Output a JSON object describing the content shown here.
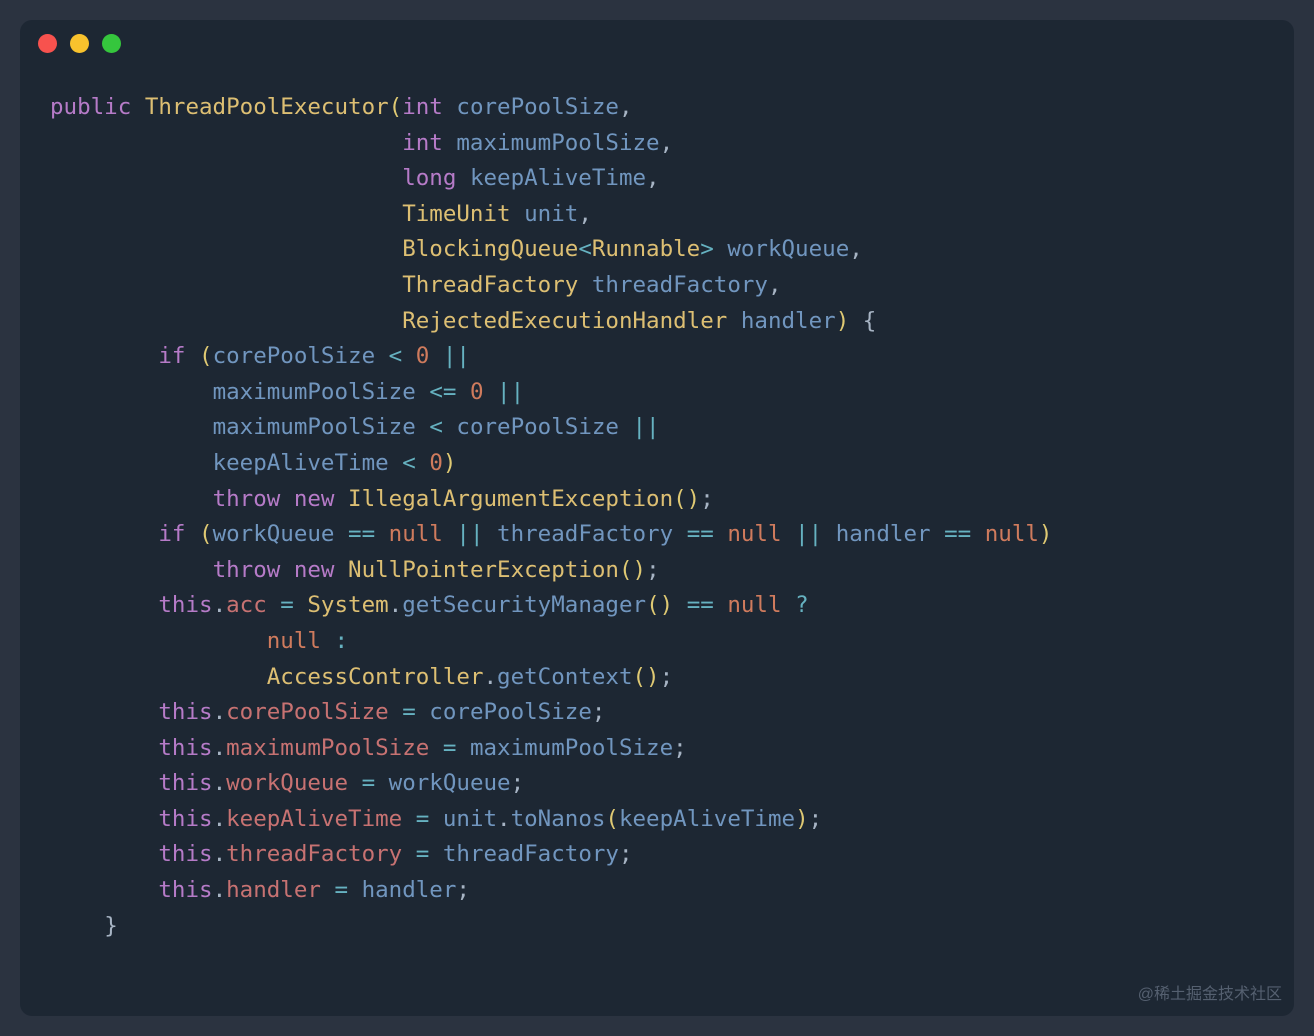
{
  "titlebar": {
    "dots": [
      "red",
      "yellow",
      "green"
    ]
  },
  "code": {
    "tokens": [
      [
        {
          "t": "public",
          "c": "kw-public"
        },
        {
          "t": " ",
          "c": ""
        },
        {
          "t": "ThreadPoolExecutor",
          "c": "kw-type"
        },
        {
          "t": "(",
          "c": "paren"
        },
        {
          "t": "int",
          "c": "kw-int"
        },
        {
          "t": " ",
          "c": ""
        },
        {
          "t": "corePoolSize",
          "c": "param"
        },
        {
          "t": ",",
          "c": "punct"
        }
      ],
      [
        {
          "t": "                          ",
          "c": ""
        },
        {
          "t": "int",
          "c": "kw-int"
        },
        {
          "t": " ",
          "c": ""
        },
        {
          "t": "maximumPoolSize",
          "c": "param"
        },
        {
          "t": ",",
          "c": "punct"
        }
      ],
      [
        {
          "t": "                          ",
          "c": ""
        },
        {
          "t": "long",
          "c": "kw-long"
        },
        {
          "t": " ",
          "c": ""
        },
        {
          "t": "keepAliveTime",
          "c": "param"
        },
        {
          "t": ",",
          "c": "punct"
        }
      ],
      [
        {
          "t": "                          ",
          "c": ""
        },
        {
          "t": "TimeUnit",
          "c": "kw-type"
        },
        {
          "t": " ",
          "c": ""
        },
        {
          "t": "unit",
          "c": "param"
        },
        {
          "t": ",",
          "c": "punct"
        }
      ],
      [
        {
          "t": "                          ",
          "c": ""
        },
        {
          "t": "BlockingQueue",
          "c": "kw-type"
        },
        {
          "t": "<",
          "c": "generic"
        },
        {
          "t": "Runnable",
          "c": "kw-type"
        },
        {
          "t": ">",
          "c": "generic"
        },
        {
          "t": " ",
          "c": ""
        },
        {
          "t": "workQueue",
          "c": "param"
        },
        {
          "t": ",",
          "c": "punct"
        }
      ],
      [
        {
          "t": "                          ",
          "c": ""
        },
        {
          "t": "ThreadFactory",
          "c": "kw-type"
        },
        {
          "t": " ",
          "c": ""
        },
        {
          "t": "threadFactory",
          "c": "param"
        },
        {
          "t": ",",
          "c": "punct"
        }
      ],
      [
        {
          "t": "                          ",
          "c": ""
        },
        {
          "t": "RejectedExecutionHandler",
          "c": "kw-type"
        },
        {
          "t": " ",
          "c": ""
        },
        {
          "t": "handler",
          "c": "param"
        },
        {
          "t": ")",
          "c": "paren"
        },
        {
          "t": " ",
          "c": ""
        },
        {
          "t": "{",
          "c": "curly"
        }
      ],
      [
        {
          "t": "        ",
          "c": ""
        },
        {
          "t": "if",
          "c": "kw-if"
        },
        {
          "t": " ",
          "c": ""
        },
        {
          "t": "(",
          "c": "paren"
        },
        {
          "t": "corePoolSize ",
          "c": "param"
        },
        {
          "t": "<",
          "c": "op"
        },
        {
          "t": " ",
          "c": ""
        },
        {
          "t": "0",
          "c": "num"
        },
        {
          "t": " ",
          "c": ""
        },
        {
          "t": "||",
          "c": "op"
        }
      ],
      [
        {
          "t": "            ",
          "c": ""
        },
        {
          "t": "maximumPoolSize ",
          "c": "param"
        },
        {
          "t": "<=",
          "c": "op"
        },
        {
          "t": " ",
          "c": ""
        },
        {
          "t": "0",
          "c": "num"
        },
        {
          "t": " ",
          "c": ""
        },
        {
          "t": "||",
          "c": "op"
        }
      ],
      [
        {
          "t": "            ",
          "c": ""
        },
        {
          "t": "maximumPoolSize ",
          "c": "param"
        },
        {
          "t": "<",
          "c": "op"
        },
        {
          "t": " corePoolSize ",
          "c": "param"
        },
        {
          "t": "||",
          "c": "op"
        }
      ],
      [
        {
          "t": "            ",
          "c": ""
        },
        {
          "t": "keepAliveTime ",
          "c": "param"
        },
        {
          "t": "<",
          "c": "op"
        },
        {
          "t": " ",
          "c": ""
        },
        {
          "t": "0",
          "c": "num"
        },
        {
          "t": ")",
          "c": "paren"
        }
      ],
      [
        {
          "t": "            ",
          "c": ""
        },
        {
          "t": "throw",
          "c": "kw-throw"
        },
        {
          "t": " ",
          "c": ""
        },
        {
          "t": "new",
          "c": "kw-new"
        },
        {
          "t": " ",
          "c": ""
        },
        {
          "t": "IllegalArgumentException",
          "c": "kw-type"
        },
        {
          "t": "()",
          "c": "paren"
        },
        {
          "t": ";",
          "c": "punct"
        }
      ],
      [
        {
          "t": "        ",
          "c": ""
        },
        {
          "t": "if",
          "c": "kw-if"
        },
        {
          "t": " ",
          "c": ""
        },
        {
          "t": "(",
          "c": "paren"
        },
        {
          "t": "workQueue ",
          "c": "param"
        },
        {
          "t": "==",
          "c": "op"
        },
        {
          "t": " ",
          "c": ""
        },
        {
          "t": "null",
          "c": "kw-null"
        },
        {
          "t": " ",
          "c": ""
        },
        {
          "t": "||",
          "c": "op"
        },
        {
          "t": " threadFactory ",
          "c": "param"
        },
        {
          "t": "==",
          "c": "op"
        },
        {
          "t": " ",
          "c": ""
        },
        {
          "t": "null",
          "c": "kw-null"
        },
        {
          "t": " ",
          "c": ""
        },
        {
          "t": "||",
          "c": "op"
        },
        {
          "t": " handler ",
          "c": "param"
        },
        {
          "t": "==",
          "c": "op"
        },
        {
          "t": " ",
          "c": ""
        },
        {
          "t": "null",
          "c": "kw-null"
        },
        {
          "t": ")",
          "c": "paren"
        }
      ],
      [
        {
          "t": "            ",
          "c": ""
        },
        {
          "t": "throw",
          "c": "kw-throw"
        },
        {
          "t": " ",
          "c": ""
        },
        {
          "t": "new",
          "c": "kw-new"
        },
        {
          "t": " ",
          "c": ""
        },
        {
          "t": "NullPointerException",
          "c": "kw-type"
        },
        {
          "t": "()",
          "c": "paren"
        },
        {
          "t": ";",
          "c": "punct"
        }
      ],
      [
        {
          "t": "        ",
          "c": ""
        },
        {
          "t": "this",
          "c": "kw-this"
        },
        {
          "t": ".",
          "c": "punct"
        },
        {
          "t": "acc",
          "c": "field"
        },
        {
          "t": " ",
          "c": ""
        },
        {
          "t": "=",
          "c": "op"
        },
        {
          "t": " ",
          "c": ""
        },
        {
          "t": "System",
          "c": "kw-type"
        },
        {
          "t": ".",
          "c": "punct"
        },
        {
          "t": "getSecurityManager",
          "c": "method"
        },
        {
          "t": "()",
          "c": "paren"
        },
        {
          "t": " ",
          "c": ""
        },
        {
          "t": "==",
          "c": "op"
        },
        {
          "t": " ",
          "c": ""
        },
        {
          "t": "null",
          "c": "kw-null"
        },
        {
          "t": " ",
          "c": ""
        },
        {
          "t": "?",
          "c": "op"
        }
      ],
      [
        {
          "t": "                ",
          "c": ""
        },
        {
          "t": "null",
          "c": "kw-null"
        },
        {
          "t": " ",
          "c": ""
        },
        {
          "t": ":",
          "c": "op"
        }
      ],
      [
        {
          "t": "                ",
          "c": ""
        },
        {
          "t": "AccessController",
          "c": "kw-type"
        },
        {
          "t": ".",
          "c": "punct"
        },
        {
          "t": "getContext",
          "c": "method"
        },
        {
          "t": "()",
          "c": "paren"
        },
        {
          "t": ";",
          "c": "punct"
        }
      ],
      [
        {
          "t": "        ",
          "c": ""
        },
        {
          "t": "this",
          "c": "kw-this"
        },
        {
          "t": ".",
          "c": "punct"
        },
        {
          "t": "corePoolSize",
          "c": "field"
        },
        {
          "t": " ",
          "c": ""
        },
        {
          "t": "=",
          "c": "op"
        },
        {
          "t": " corePoolSize",
          "c": "param"
        },
        {
          "t": ";",
          "c": "punct"
        }
      ],
      [
        {
          "t": "        ",
          "c": ""
        },
        {
          "t": "this",
          "c": "kw-this"
        },
        {
          "t": ".",
          "c": "punct"
        },
        {
          "t": "maximumPoolSize",
          "c": "field"
        },
        {
          "t": " ",
          "c": ""
        },
        {
          "t": "=",
          "c": "op"
        },
        {
          "t": " maximumPoolSize",
          "c": "param"
        },
        {
          "t": ";",
          "c": "punct"
        }
      ],
      [
        {
          "t": "        ",
          "c": ""
        },
        {
          "t": "this",
          "c": "kw-this"
        },
        {
          "t": ".",
          "c": "punct"
        },
        {
          "t": "workQueue",
          "c": "field"
        },
        {
          "t": " ",
          "c": ""
        },
        {
          "t": "=",
          "c": "op"
        },
        {
          "t": " workQueue",
          "c": "param"
        },
        {
          "t": ";",
          "c": "punct"
        }
      ],
      [
        {
          "t": "        ",
          "c": ""
        },
        {
          "t": "this",
          "c": "kw-this"
        },
        {
          "t": ".",
          "c": "punct"
        },
        {
          "t": "keepAliveTime",
          "c": "field"
        },
        {
          "t": " ",
          "c": ""
        },
        {
          "t": "=",
          "c": "op"
        },
        {
          "t": " unit",
          "c": "param"
        },
        {
          "t": ".",
          "c": "punct"
        },
        {
          "t": "toNanos",
          "c": "method"
        },
        {
          "t": "(",
          "c": "paren"
        },
        {
          "t": "keepAliveTime",
          "c": "param"
        },
        {
          "t": ")",
          "c": "paren"
        },
        {
          "t": ";",
          "c": "punct"
        }
      ],
      [
        {
          "t": "        ",
          "c": ""
        },
        {
          "t": "this",
          "c": "kw-this"
        },
        {
          "t": ".",
          "c": "punct"
        },
        {
          "t": "threadFactory",
          "c": "field"
        },
        {
          "t": " ",
          "c": ""
        },
        {
          "t": "=",
          "c": "op"
        },
        {
          "t": " threadFactory",
          "c": "param"
        },
        {
          "t": ";",
          "c": "punct"
        }
      ],
      [
        {
          "t": "        ",
          "c": ""
        },
        {
          "t": "this",
          "c": "kw-this"
        },
        {
          "t": ".",
          "c": "punct"
        },
        {
          "t": "handler",
          "c": "field"
        },
        {
          "t": " ",
          "c": ""
        },
        {
          "t": "=",
          "c": "op"
        },
        {
          "t": " handler",
          "c": "param"
        },
        {
          "t": ";",
          "c": "punct"
        }
      ],
      [
        {
          "t": "    ",
          "c": ""
        },
        {
          "t": "}",
          "c": "curly"
        }
      ]
    ]
  },
  "watermark": "@稀土掘金技术社区"
}
